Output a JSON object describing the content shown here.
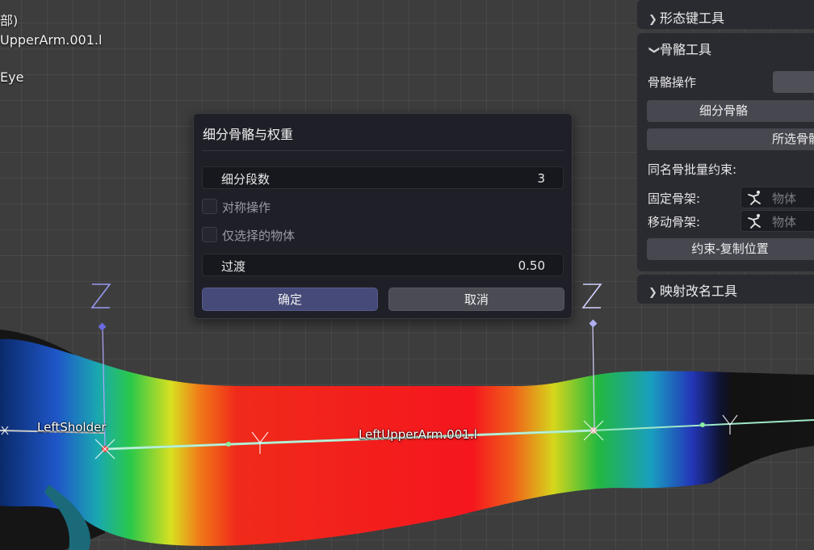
{
  "viewport": {
    "overlay_lines": [
      "部)",
      "UpperArm.001.l",
      "Eye"
    ],
    "bone_labels": {
      "left_shoulder": "LeftSholder",
      "left_upper_arm": "LeftUpperArm.001.l"
    },
    "axis_labels": [
      "Z",
      "Z"
    ]
  },
  "dialog": {
    "title": "细分骨骼与权重",
    "segments": {
      "label": "细分段数",
      "value": "3"
    },
    "symmetric": {
      "label": "对称操作",
      "checked": false
    },
    "selected_only": {
      "label": "仅选择的物体",
      "checked": false
    },
    "falloff": {
      "label": "过渡",
      "value": "0.50"
    },
    "ok_label": "确定",
    "cancel_label": "取消"
  },
  "panel": {
    "shape_keys_header": "形态键工具",
    "bone_tools_header": "骨骼工具",
    "bone_ops_label": "骨骼操作",
    "subdivide_button": "细分骨骼",
    "selected_bones_button": "所选骨骼材",
    "batch_constraint_label": "同名骨批量约束:",
    "fixed_armature_label": "固定骨架:",
    "moving_armature_label": "移动骨架:",
    "object_placeholder": "物体",
    "copy_location_button": "约束-复制位置",
    "rename_mapping_header": "映射改名工具"
  },
  "colors": {
    "dialog_bg": "#1f2027",
    "ok_button": "#454a78",
    "panel_bg": "#2a2b31",
    "bone_line": "#9fe8c8"
  }
}
